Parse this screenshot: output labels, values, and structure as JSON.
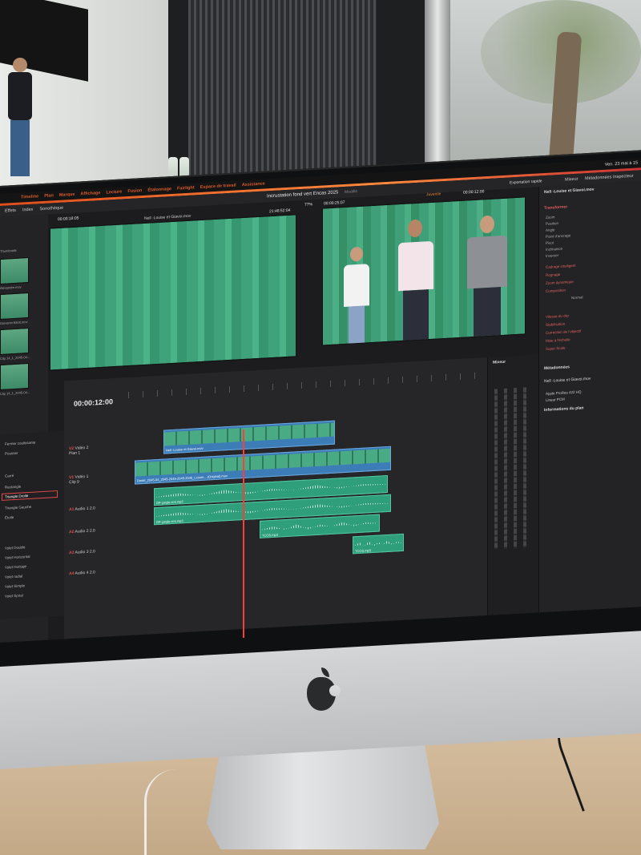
{
  "app": {
    "menu": [
      "Timeline",
      "Plan",
      "Marque",
      "Affichage",
      "Lecture",
      "Fusion",
      "Étalonnage",
      "Fairlight",
      "Espace de travail",
      "Assistance"
    ],
    "clock": "Ven. 23 mai à 15"
  },
  "toolbar": {
    "effects": "Effets",
    "index": "Index",
    "sound_lib": "Sonothèque",
    "project_title": "Incrustation fond vert Encas 2025",
    "project_status": "Modifié",
    "export": "Exportation rapide",
    "mixer": "Mixeur",
    "metadata": "Métadonnées",
    "inspector": "Inspecteur"
  },
  "media": {
    "timecode": "00:00:18:05",
    "clips": [
      "Thumbnails",
      "Alexandre.mov",
      "Giovanni Eliott.mov",
      "Clip 14_1_2045-04...",
      "Clip 14_1_2045-04..."
    ]
  },
  "source_viewer": {
    "clip_name": "Nell -Louise et Giavoi.mov",
    "timecode": "21:48:52:04",
    "zoom": "77%"
  },
  "program_viewer": {
    "timecode": "00:00:25:07",
    "timeline_label": "Juvenile",
    "record_tc": "00:00:12:00"
  },
  "inspector": {
    "clip_name": "Nell -Louise et Giavoi.mov",
    "transform": "Transformer",
    "fields": [
      "Zoom",
      "Position",
      "Angle",
      "Point d'ancrage",
      "Pivot",
      "Inclinaison",
      "Inverser"
    ],
    "sections": [
      "Cadrage intelligent",
      "Rognage",
      "Zoom dynamique",
      "Composition",
      "Vitesse du clip",
      "Stabilisation",
      "Correction de l'objectif",
      "Mise à l'échelle",
      "Super Scale"
    ],
    "composite_mode": "Normal",
    "metadata_title": "Métadonnées",
    "metadata_sub": "Informations du plan",
    "codec": "Apple ProRes 422 HQ",
    "pcm": "Linear PCM"
  },
  "timeline": {
    "timecode": "00:00:12:00",
    "tracks": [
      {
        "id": "V2",
        "name": "Vidéo 2",
        "sub": "Plan 1"
      },
      {
        "id": "V1",
        "name": "Vidéo 1",
        "sub": "Clip 9"
      },
      {
        "id": "A1",
        "name": "Audio 1",
        "sub": "2.0"
      },
      {
        "id": "A2",
        "name": "Audio 2",
        "sub": "2.0"
      },
      {
        "id": "A3",
        "name": "Audio 3",
        "sub": "2.0"
      },
      {
        "id": "A4",
        "name": "Audio 4",
        "sub": "2.0"
      }
    ],
    "clip_v2": "Nell -Louise et Giavoi.mov",
    "clip_v1": "Dmitri_2045-04_2045-2045-2045-2045_Lzoom... (Original).mov",
    "clip_a1": "DP-jungle-rmt.mp3",
    "clip_a2": "DP-jungle-rmt.mp3",
    "clip_a3": "TCOS.mp3"
  },
  "effects": {
    "items": [
      "Fermer coulissante",
      "Pousser",
      "Carré",
      "Rectangle",
      "Triangle Droite",
      "Triangle Gauche",
      "Étoile",
      "Volet Double",
      "Volet Horizontal",
      "Volet Horloge",
      "Volet radial",
      "Volet Simple",
      "Volet Spiral"
    ],
    "selected": "Triangle Droite"
  },
  "colors": {
    "accent": "#e04d1d",
    "green_screen": "#3fa27a",
    "video_clip": "#3c7db8",
    "audio_clip": "#2f9e7a",
    "playhead": "#ff3b3b"
  }
}
